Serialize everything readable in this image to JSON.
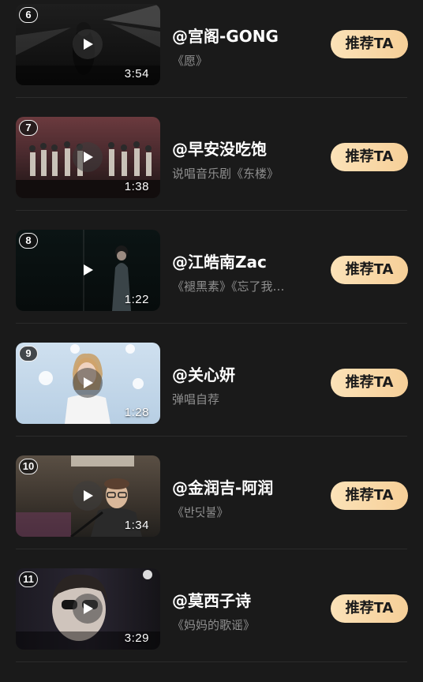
{
  "recommend_label": "推荐TA",
  "items": [
    {
      "rank": "6",
      "name": "@宫阁-GONG",
      "desc": "《愿》",
      "duration": "3:54"
    },
    {
      "rank": "7",
      "name": "@早安没吃饱",
      "desc": "说唱音乐剧《东楼》",
      "duration": "1:38"
    },
    {
      "rank": "8",
      "name": "@江皓南Zac",
      "desc": "《褪黑素》《忘了我…",
      "duration": "1:22"
    },
    {
      "rank": "9",
      "name": "@关心妍",
      "desc": "弹唱自荐",
      "duration": "1:28"
    },
    {
      "rank": "10",
      "name": "@金润吉-阿润",
      "desc": "《반딧불》",
      "duration": "1:34"
    },
    {
      "rank": "11",
      "name": "@莫西子诗",
      "desc": "《妈妈的歌谣》",
      "duration": "3:29"
    }
  ],
  "colors": {
    "background": "#1a1a1a",
    "button_start": "#fbe2b8",
    "button_end": "#f6cf98",
    "desc_text": "#8f8f8f"
  }
}
